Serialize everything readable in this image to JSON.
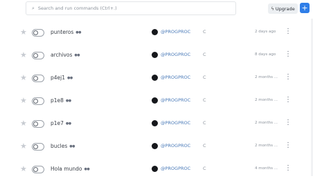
{
  "header": {
    "search_icon": "search-icon",
    "search_placeholder": "Search and run commands (Ctrl+.)",
    "upgrade_icon": "bolt-icon",
    "upgrade_label": "Upgrade",
    "new_label": "+"
  },
  "repls": [
    {
      "name": "punteros",
      "owner": "@PROGPROC",
      "language": "C",
      "updated": "2 days ago"
    },
    {
      "name": "archivos",
      "owner": "@PROGPROC",
      "language": "C",
      "updated": "8 days ago"
    },
    {
      "name": "p4ej1",
      "owner": "@PROGPROC",
      "language": "C",
      "updated": "2 months ..."
    },
    {
      "name": "p1e8",
      "owner": "@PROGPROC",
      "language": "C",
      "updated": "2 months ..."
    },
    {
      "name": "p1e7",
      "owner": "@PROGPROC",
      "language": "C",
      "updated": "2 months ..."
    },
    {
      "name": "bucles",
      "owner": "@PROGPROC",
      "language": "C",
      "updated": "2 months ..."
    },
    {
      "name": "Hola mundo",
      "owner": "@PROGPROC",
      "language": "C",
      "updated": "4 months ..."
    }
  ]
}
